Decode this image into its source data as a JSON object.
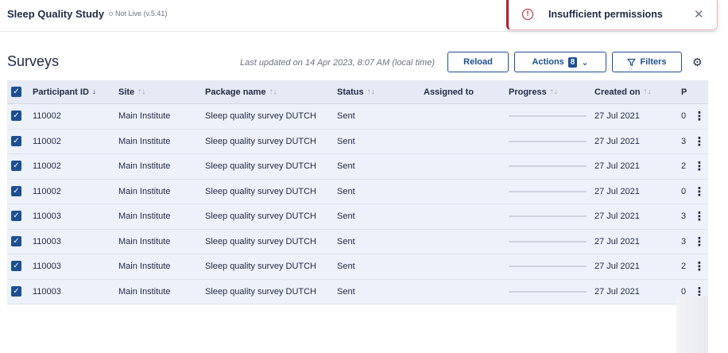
{
  "app": {
    "title": "Sleep Quality Study",
    "live_status": "Not Live (v.5.41)"
  },
  "toast": {
    "icon": "error-icon",
    "message": "Insufficient permissions",
    "close_icon": "close-icon"
  },
  "page": {
    "title": "Surveys",
    "last_updated": "Last updated on 14 Apr 2023, 8:07 AM (local time)"
  },
  "toolbar": {
    "reload_label": "Reload",
    "actions_label": "Actions",
    "actions_count": "8",
    "filters_label": "Filters",
    "settings_icon": "gear-icon"
  },
  "table": {
    "columns": {
      "participant_id": "Participant ID",
      "site": "Site",
      "package_name": "Package name",
      "status": "Status",
      "assigned_to": "Assigned to",
      "progress": "Progress",
      "created_on": "Created on",
      "extra": "P"
    },
    "rows": [
      {
        "participant_id": "110002",
        "site": "Main Institute",
        "package_name": "Sleep quality survey DUTCH",
        "status": "Sent",
        "assigned_to": "",
        "progress": 0,
        "created_on": "27 Jul 2021",
        "extra": "0"
      },
      {
        "participant_id": "110002",
        "site": "Main Institute",
        "package_name": "Sleep quality survey DUTCH",
        "status": "Sent",
        "assigned_to": "",
        "progress": 0,
        "created_on": "27 Jul 2021",
        "extra": "3"
      },
      {
        "participant_id": "110002",
        "site": "Main Institute",
        "package_name": "Sleep quality survey DUTCH",
        "status": "Sent",
        "assigned_to": "",
        "progress": 0,
        "created_on": "27 Jul 2021",
        "extra": "2"
      },
      {
        "participant_id": "110002",
        "site": "Main Institute",
        "package_name": "Sleep quality survey DUTCH",
        "status": "Sent",
        "assigned_to": "",
        "progress": 0,
        "created_on": "27 Jul 2021",
        "extra": "0"
      },
      {
        "participant_id": "110003",
        "site": "Main Institute",
        "package_name": "Sleep quality survey DUTCH",
        "status": "Sent",
        "assigned_to": "",
        "progress": 0,
        "created_on": "27 Jul 2021",
        "extra": "3"
      },
      {
        "participant_id": "110003",
        "site": "Main Institute",
        "package_name": "Sleep quality survey DUTCH",
        "status": "Sent",
        "assigned_to": "",
        "progress": 0,
        "created_on": "27 Jul 2021",
        "extra": "3"
      },
      {
        "participant_id": "110003",
        "site": "Main Institute",
        "package_name": "Sleep quality survey DUTCH",
        "status": "Sent",
        "assigned_to": "",
        "progress": 0,
        "created_on": "27 Jul 2021",
        "extra": "2"
      },
      {
        "participant_id": "110003",
        "site": "Main Institute",
        "package_name": "Sleep quality survey DUTCH",
        "status": "Sent",
        "assigned_to": "",
        "progress": 0,
        "created_on": "27 Jul 2021",
        "extra": "0"
      }
    ]
  },
  "colors": {
    "accent": "#1d4f91",
    "error": "#b3202e",
    "row_selected": "#edf1fa"
  }
}
